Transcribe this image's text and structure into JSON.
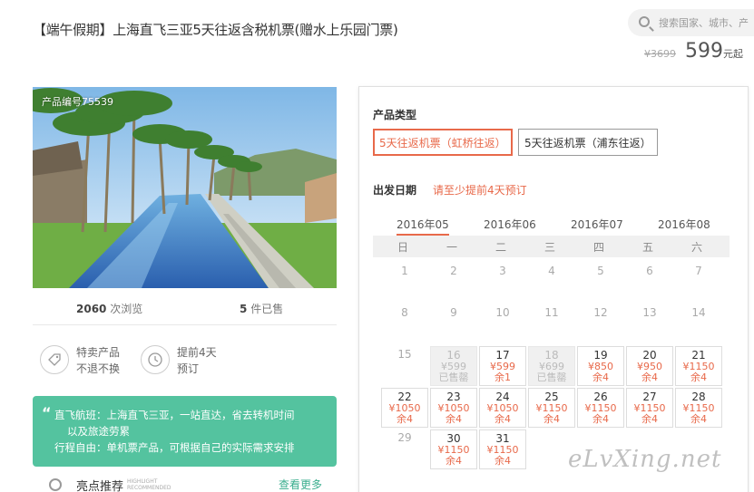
{
  "header": {
    "title": "【端午假期】上海直飞三亚5天往返含税机票(赠水上乐园门票)",
    "search_placeholder": "搜索国家、城市、产",
    "old_price": "¥3699",
    "price": "599",
    "price_unit": "元起"
  },
  "gallery": {
    "product_code": "产品编号75539"
  },
  "stats": {
    "views_num": "2060",
    "views_label": "次浏览",
    "sold_num": "5",
    "sold_label": "件已售"
  },
  "features": [
    {
      "line1": "特卖产品",
      "line2": "不退不换",
      "icon": "tag-icon"
    },
    {
      "line1": "提前4天",
      "line2": "预订",
      "icon": "clock-icon"
    }
  ],
  "notes": {
    "line1": "直飞航班：上海直飞三亚，一站直达，省去转机时间",
    "line2": "以及旅途劳累",
    "line3": "行程自由：单机票产品，可根据自己的实际需求安排"
  },
  "highlight": {
    "label": "亮点推荐",
    "en1": "HIGHLIGHT",
    "en2": "RECOMMENDED",
    "more": "查看更多"
  },
  "booking": {
    "product_type_label": "产品类型",
    "types": [
      "5天往返机票（虹桥往返）",
      "5天往返机票（浦东往返）"
    ],
    "date_label": "出发日期",
    "date_hint": "请至少提前4天预订",
    "months": [
      "2016年05",
      "2016年06",
      "2016年07",
      "2016年08"
    ],
    "weekdays": [
      "日",
      "一",
      "二",
      "三",
      "四",
      "五",
      "六"
    ],
    "days": [
      {
        "n": "1"
      },
      {
        "n": "2"
      },
      {
        "n": "3"
      },
      {
        "n": "4"
      },
      {
        "n": "5"
      },
      {
        "n": "6"
      },
      {
        "n": "7"
      },
      {
        "n": "8"
      },
      {
        "n": "9"
      },
      {
        "n": "10"
      },
      {
        "n": "11"
      },
      {
        "n": "12"
      },
      {
        "n": "13"
      },
      {
        "n": "14"
      },
      {
        "n": "15"
      },
      {
        "n": "16",
        "p": "¥599",
        "s": "已售罄",
        "soldout": true
      },
      {
        "n": "17",
        "p": "¥599",
        "s": "余1"
      },
      {
        "n": "18",
        "p": "¥699",
        "s": "已售罄",
        "soldout": true
      },
      {
        "n": "19",
        "p": "¥850",
        "s": "余4"
      },
      {
        "n": "20",
        "p": "¥950",
        "s": "余4"
      },
      {
        "n": "21",
        "p": "¥1150",
        "s": "余4"
      },
      {
        "n": "22",
        "p": "¥1050",
        "s": "余4"
      },
      {
        "n": "23",
        "p": "¥1050",
        "s": "余4"
      },
      {
        "n": "24",
        "p": "¥1050",
        "s": "余4"
      },
      {
        "n": "25",
        "p": "¥1150",
        "s": "余4"
      },
      {
        "n": "26",
        "p": "¥1150",
        "s": "余4"
      },
      {
        "n": "27",
        "p": "¥1150",
        "s": "余4"
      },
      {
        "n": "28",
        "p": "¥1150",
        "s": "余4"
      },
      {
        "n": "29"
      },
      {
        "n": "30",
        "p": "¥1150",
        "s": "余4"
      },
      {
        "n": "31",
        "p": "¥1150",
        "s": "余4"
      }
    ]
  },
  "watermark": "eLvXing.net"
}
